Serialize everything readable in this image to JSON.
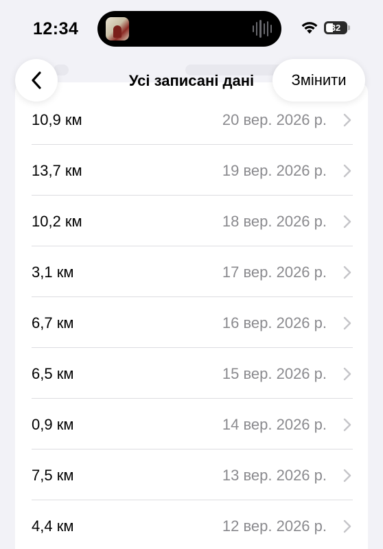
{
  "status_bar": {
    "time": "12:34",
    "battery": "32"
  },
  "nav": {
    "title": "Усі записані дані",
    "edit_label": "Змінити"
  },
  "rows": [
    {
      "distance": "10,9 км",
      "date": "20 вер. 2026 р."
    },
    {
      "distance": "13,7 км",
      "date": "19 вер. 2026 р."
    },
    {
      "distance": "10,2 км",
      "date": "18 вер. 2026 р."
    },
    {
      "distance": "3,1 км",
      "date": "17 вер. 2026 р."
    },
    {
      "distance": "6,7 км",
      "date": "16 вер. 2026 р."
    },
    {
      "distance": "6,5 км",
      "date": "15 вер. 2026 р."
    },
    {
      "distance": "0,9 км",
      "date": "14 вер. 2026 р."
    },
    {
      "distance": "7,5 км",
      "date": "13 вер. 2026 р."
    },
    {
      "distance": "4,4 км",
      "date": "12 вер. 2026 р."
    }
  ],
  "colors": {
    "background": "#f2f2f7",
    "secondary_text": "#8a8a8e",
    "separator": "#dcdce0"
  },
  "icons": {
    "back": "chevron-left-icon",
    "row": "chevron-right-icon",
    "wifi": "wifi-icon",
    "battery": "battery-icon",
    "waveform": "audio-waveform-icon",
    "album": "album-art"
  }
}
